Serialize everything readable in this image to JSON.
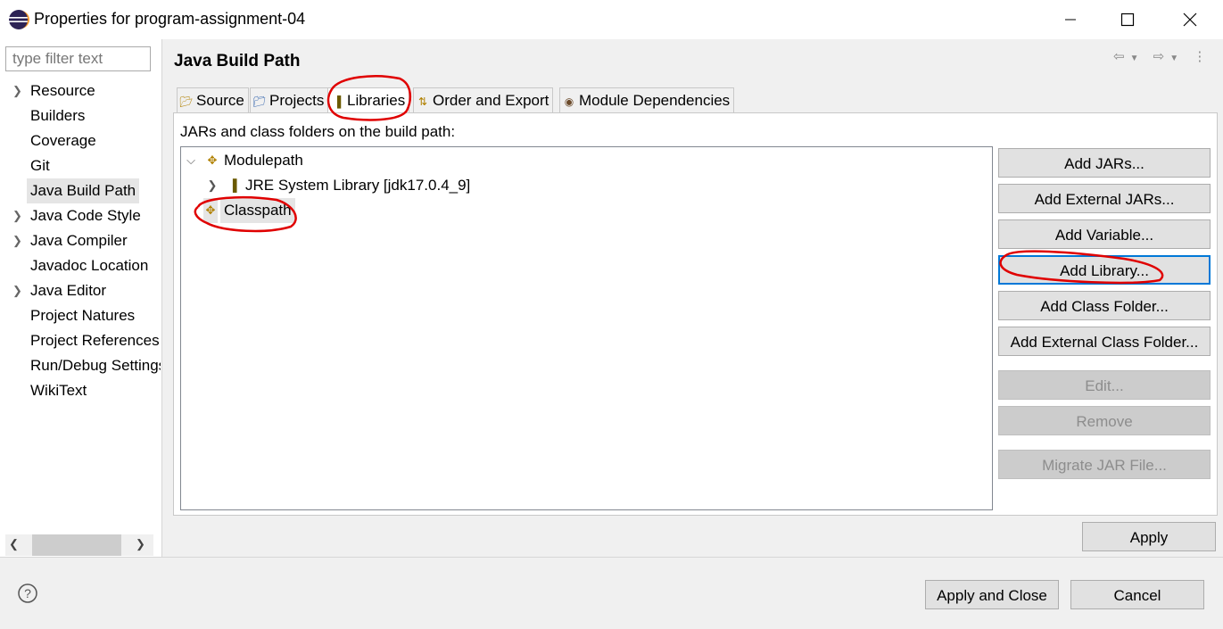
{
  "window": {
    "title": "Properties for program-assignment-04"
  },
  "filter": {
    "placeholder": "type filter text"
  },
  "nav": {
    "items": [
      {
        "label": "Resource",
        "expandable": true
      },
      {
        "label": "Builders",
        "expandable": false
      },
      {
        "label": "Coverage",
        "expandable": false
      },
      {
        "label": "Git",
        "expandable": false
      },
      {
        "label": "Java Build Path",
        "expandable": false,
        "selected": true
      },
      {
        "label": "Java Code Style",
        "expandable": true
      },
      {
        "label": "Java Compiler",
        "expandable": true
      },
      {
        "label": "Javadoc Location",
        "expandable": false
      },
      {
        "label": "Java Editor",
        "expandable": true
      },
      {
        "label": "Project Natures",
        "expandable": false
      },
      {
        "label": "Project References",
        "expandable": false
      },
      {
        "label": "Run/Debug Settings",
        "expandable": false
      },
      {
        "label": "WikiText",
        "expandable": false
      }
    ]
  },
  "page": {
    "title": "Java Build Path"
  },
  "tabs": [
    {
      "label": "Source",
      "icon": "source-folder-icon"
    },
    {
      "label": "Projects",
      "icon": "projects-folder-icon"
    },
    {
      "label": "Libraries",
      "icon": "libraries-icon",
      "active": true
    },
    {
      "label": "Order and Export",
      "icon": "order-export-icon"
    },
    {
      "label": "Module Dependencies",
      "icon": "module-icon"
    }
  ],
  "libraries": {
    "description": "JARs and class folders on the build path:",
    "tree": {
      "modulepath": "Modulepath",
      "jre": "JRE System Library [jdk17.0.4_9]",
      "classpath": "Classpath"
    }
  },
  "buttons": {
    "add_jars": "Add JARs...",
    "add_external_jars": "Add External JARs...",
    "add_variable": "Add Variable...",
    "add_library": "Add Library...",
    "add_class_folder": "Add Class Folder...",
    "add_external_class_folder": "Add External Class Folder...",
    "edit": "Edit...",
    "remove": "Remove",
    "migrate_jar": "Migrate JAR File..."
  },
  "footer": {
    "apply": "Apply",
    "apply_and_close": "Apply and Close",
    "cancel": "Cancel"
  },
  "colors": {
    "focus": "#0078d7",
    "annotation": "#e00000",
    "selection": "#e5e5e5"
  }
}
